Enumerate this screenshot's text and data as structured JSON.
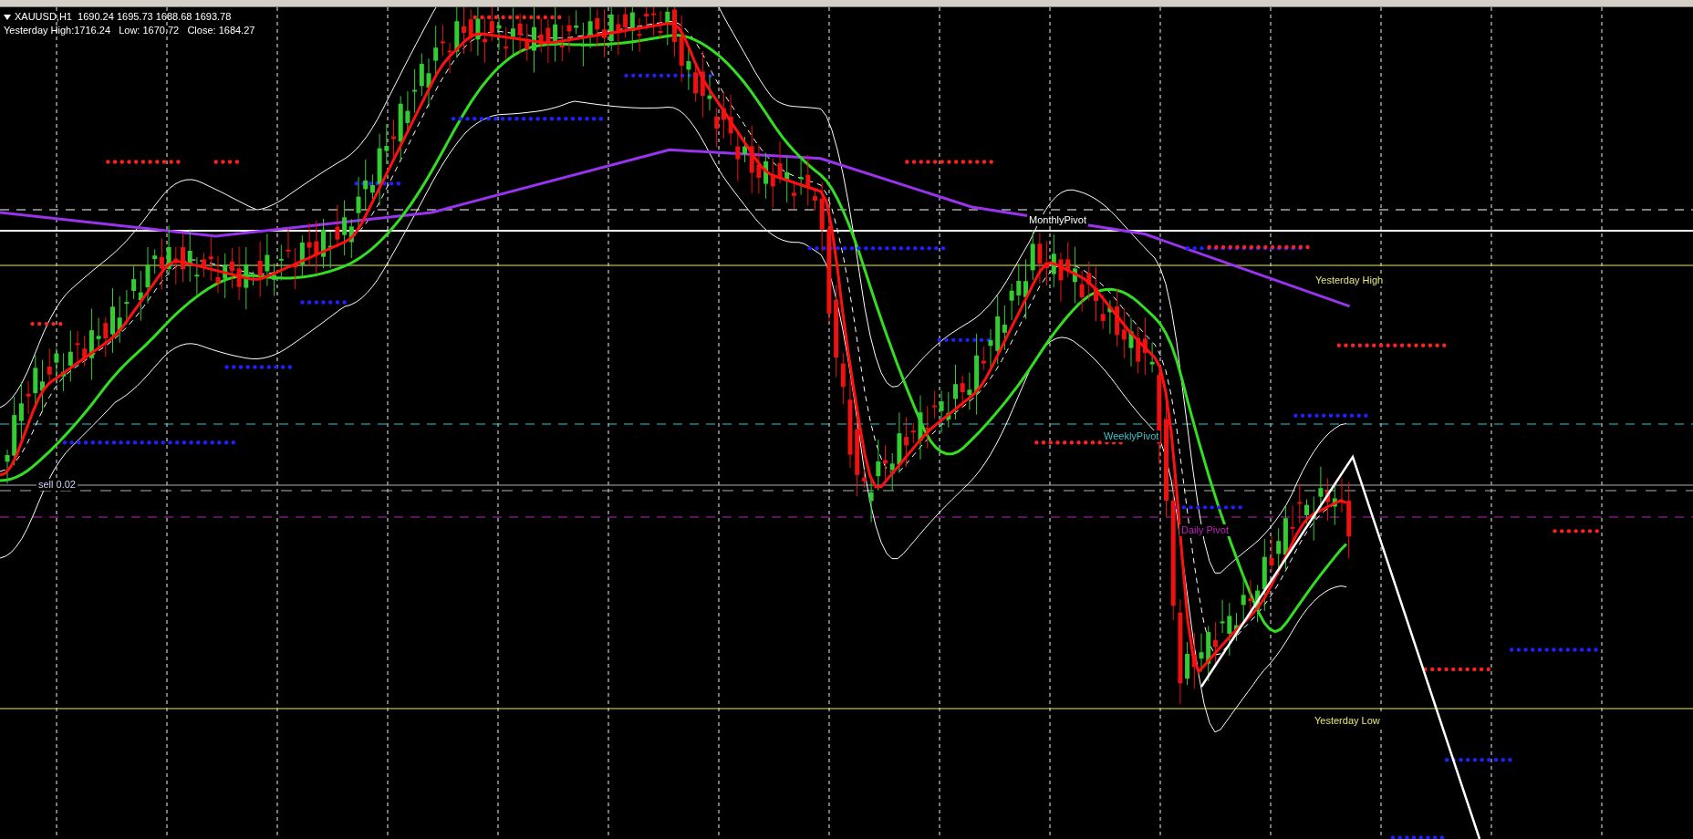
{
  "chart": {
    "symbol_line": "XAUUSD,H1  1690.24 1695.73 1688.68 1693.78",
    "yesterday_line": "Yesterday High:1716.24   Low: 1670.72   Close: 1684.27",
    "order_label": "sell 0.02",
    "levels": [
      {
        "label": "MonthlyPivot",
        "color": "#ffffff"
      },
      {
        "label": "Yesterday High",
        "color": "#e6e67a"
      },
      {
        "label": "WeeklyPivot",
        "color": "#40c0c8"
      },
      {
        "label": "Daily Pivot",
        "color": "#c020c0"
      },
      {
        "label": "Yesterday Low",
        "color": "#e6e67a"
      }
    ]
  }
}
